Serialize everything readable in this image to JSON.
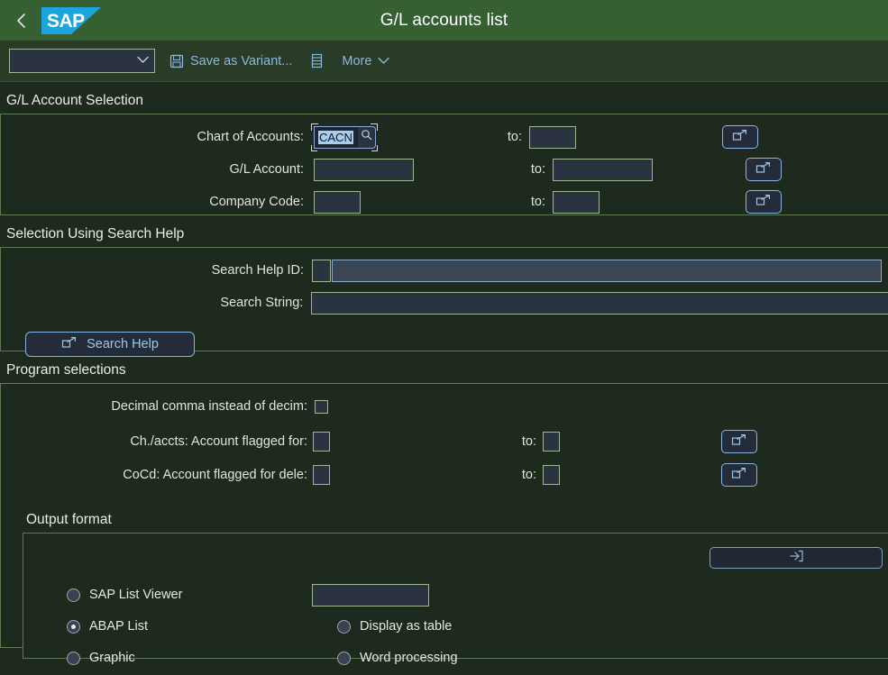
{
  "shell": {
    "back_icon": "chevron-left-icon",
    "logo_text": "SAP",
    "title": "G/L accounts list"
  },
  "toolbar": {
    "variant_value": "",
    "variant_chevron": "⌄",
    "save_variant_label": "Save as Variant...",
    "save_icon": "floppy-disk-icon",
    "list_icon": "list-icon",
    "more_label": "More",
    "more_chevron": "⌄"
  },
  "sections": {
    "gl_account_selection": {
      "title": "G/L Account Selection",
      "rows": [
        {
          "label": "Chart of Accounts:",
          "value": "CACN",
          "focused": true,
          "has_f4": true,
          "to_label": "to:",
          "to_value": "",
          "multi_select": true
        },
        {
          "label": "G/L Account:",
          "value": "",
          "focused": false,
          "has_f4": false,
          "to_label": "to:",
          "to_value": "",
          "multi_select": true
        },
        {
          "label": "Company Code:",
          "value": "",
          "focused": false,
          "has_f4": false,
          "to_label": "to:",
          "to_value": "",
          "multi_select": true
        }
      ]
    },
    "search_help": {
      "title": "Selection Using Search Help",
      "search_help_id_label": "Search Help ID:",
      "search_help_id_value": "",
      "search_help_id_desc": "",
      "search_string_label": "Search String:",
      "search_string_value": "",
      "button_label": "Search Help",
      "button_icon": "open-in-new-icon"
    },
    "program_selections": {
      "title": "Program selections",
      "decimal_label": "Decimal comma instead of decim:",
      "decimal_checked": false,
      "rows": [
        {
          "label": "Ch./accts: Account flagged for:",
          "value": "",
          "to_label": "to:",
          "to_value": ""
        },
        {
          "label": "CoCd: Account flagged for dele:",
          "value": "",
          "to_label": "to:",
          "to_value": ""
        }
      ]
    },
    "output_format": {
      "title": "Output format",
      "layout_value": "",
      "layout_icon_button": "enter-into-box-icon",
      "options_left": [
        {
          "label": "SAP List Viewer",
          "selected": false
        },
        {
          "label": "ABAP List",
          "selected": true
        },
        {
          "label": "Graphic",
          "selected": false
        }
      ],
      "options_right": [
        {
          "label": "Display as table",
          "selected": false
        },
        {
          "label": "Word processing",
          "selected": false
        }
      ]
    }
  },
  "colors": {
    "header_green": "#365f32",
    "toolbar_green": "#2a3b28",
    "content_bg": "#1e2a1e",
    "panel_border": "#5d7a55",
    "field_bg": "#2b3340",
    "field_border": "#9fb894",
    "accent_blue": "#89b9e0",
    "logo_blue": "#1ca5dd",
    "selection_blue": "#a8cdf0"
  }
}
